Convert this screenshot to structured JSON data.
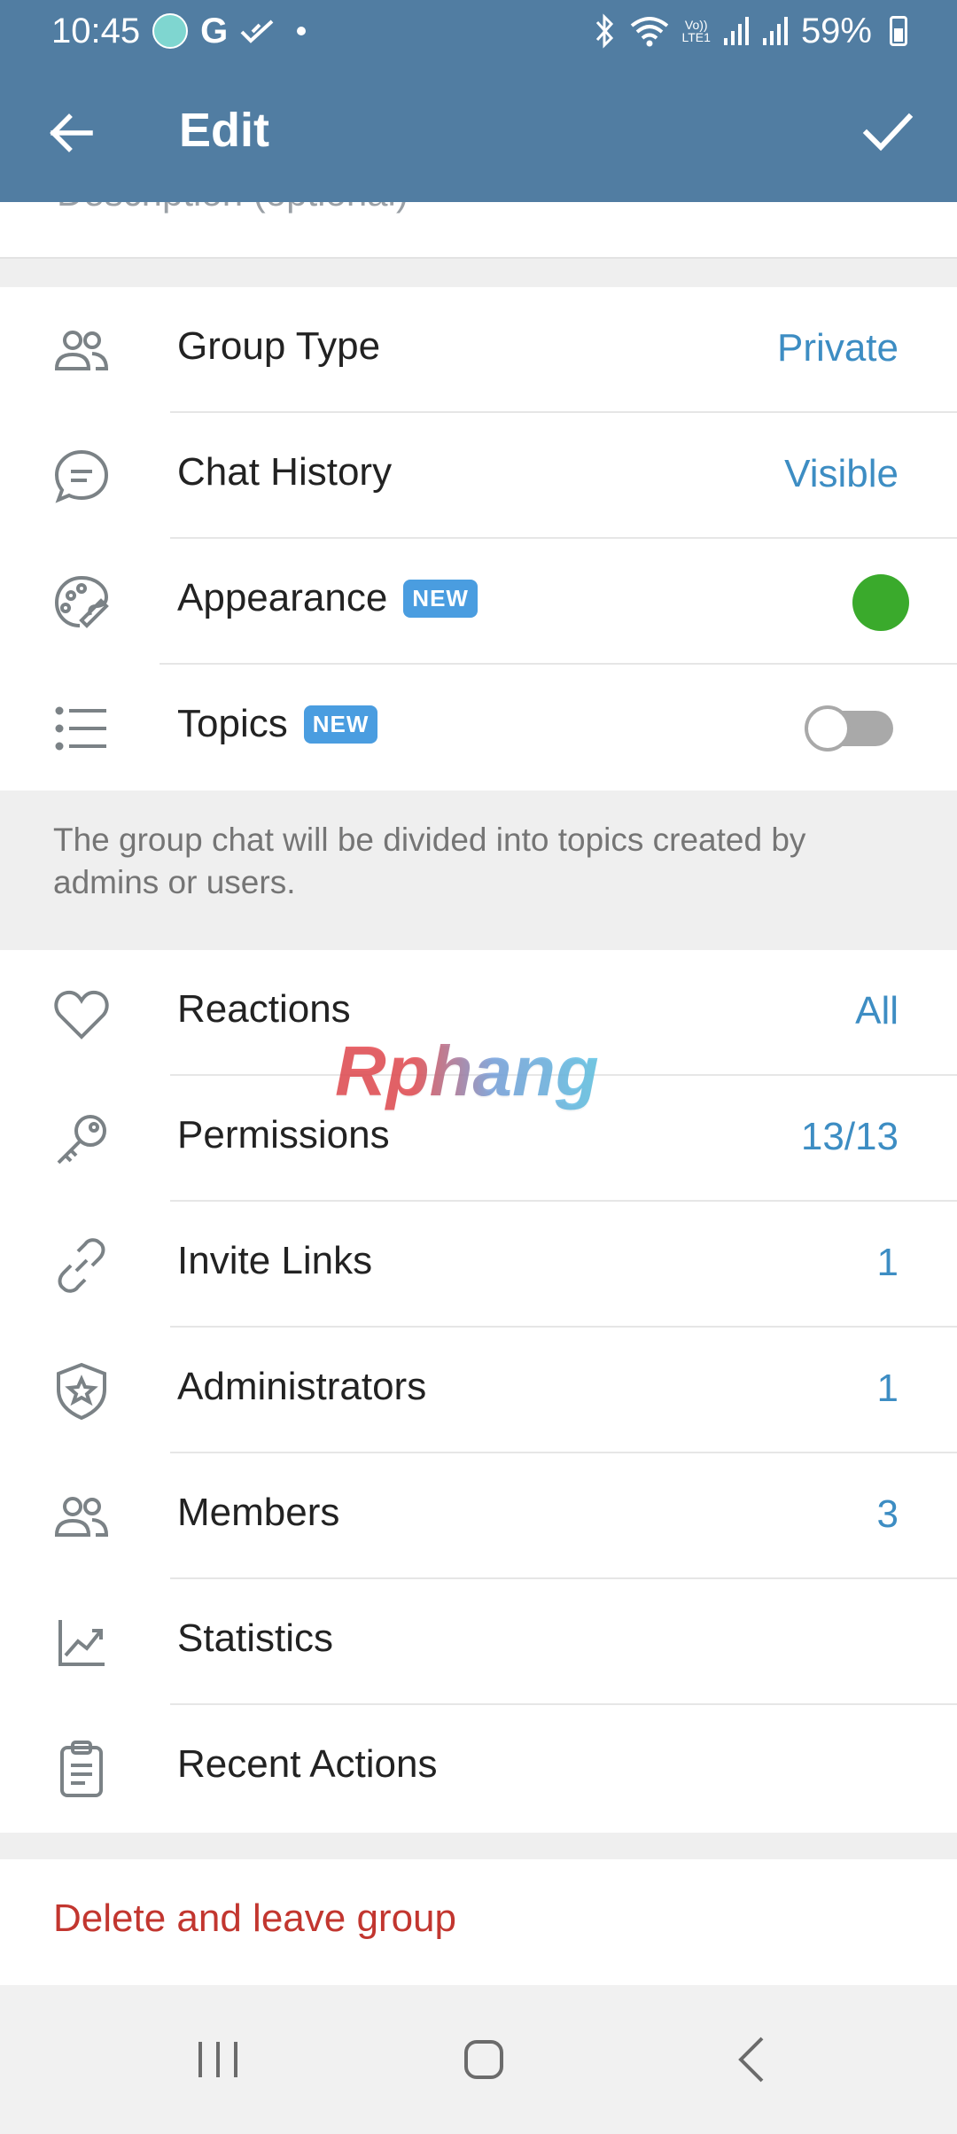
{
  "status_bar": {
    "time": "10:45",
    "g_letter": "G",
    "volte_top": "Vo))",
    "volte_bottom": "LTE1",
    "battery": "59%"
  },
  "app_bar": {
    "title": "Edit",
    "icons": {
      "back": "arrow-left-icon",
      "confirm": "check-icon"
    }
  },
  "description": {
    "placeholder": "Description (optional)"
  },
  "section1": {
    "rows": [
      {
        "label": "Group Type",
        "value": "Private",
        "icon": "group-icon"
      },
      {
        "label": "Chat History",
        "value": "Visible",
        "icon": "chat-bubble-icon"
      },
      {
        "label": "Appearance",
        "badge": "NEW",
        "icon": "palette-icon",
        "color": "#3aaa2c"
      },
      {
        "label": "Topics",
        "badge": "NEW",
        "icon": "list-icon",
        "toggle": false
      }
    ],
    "info": "The group chat will be divided into topics created by admins or users."
  },
  "section2": {
    "rows": [
      {
        "label": "Reactions",
        "value": "All",
        "icon": "heart-icon"
      },
      {
        "label": "Permissions",
        "value": "13/13",
        "icon": "key-icon"
      },
      {
        "label": "Invite Links",
        "value": "1",
        "icon": "link-icon"
      },
      {
        "label": "Administrators",
        "value": "1",
        "icon": "shield-star-icon"
      },
      {
        "label": "Members",
        "value": "3",
        "icon": "members-icon"
      },
      {
        "label": "Statistics",
        "icon": "stats-icon"
      },
      {
        "label": "Recent Actions",
        "icon": "clipboard-icon"
      }
    ]
  },
  "delete": {
    "label": "Delete and leave group",
    "color": "#c2362f"
  },
  "watermark": "Rphang",
  "colors": {
    "header": "#517da2",
    "accent": "#3d8dc3",
    "badge": "#4a9de0"
  }
}
